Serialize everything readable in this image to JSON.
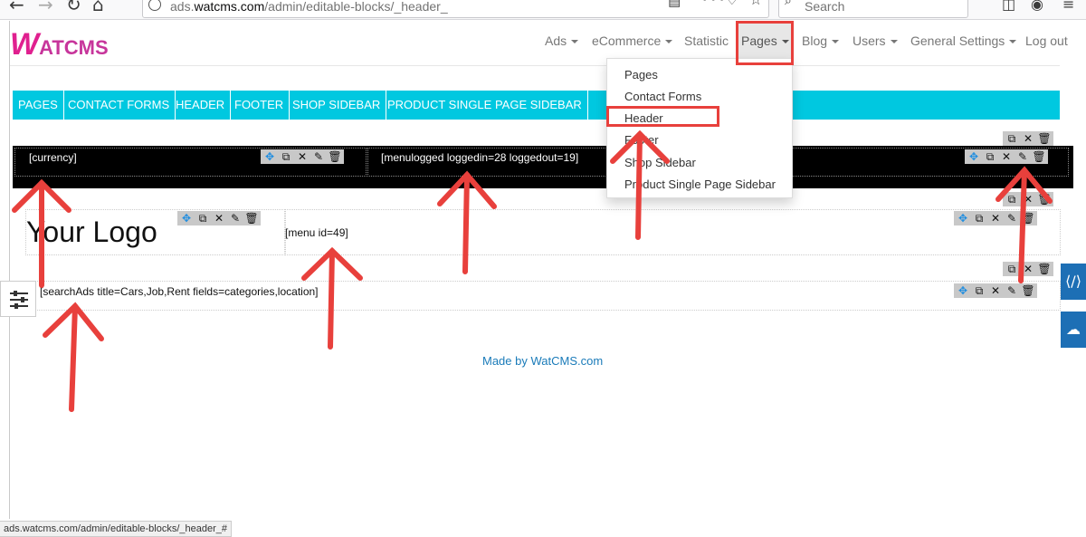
{
  "browser": {
    "url_prefix": "ads.",
    "url_domain": "watcms.com",
    "url_path": "/admin/editable-blocks/_header_",
    "search_placeholder": "Search",
    "status_url": "ads.watcms.com/admin/editable-blocks/_header_#"
  },
  "brand": {
    "logo_w": "W",
    "logo_rest": "ATCMS"
  },
  "navbar": {
    "items": [
      {
        "label": "Ads",
        "caret": true
      },
      {
        "label": "eCommerce",
        "caret": true
      },
      {
        "label": "Statistic",
        "caret": false
      },
      {
        "label": "Pages",
        "caret": true
      },
      {
        "label": "Blog",
        "caret": true
      },
      {
        "label": "Users",
        "caret": true
      },
      {
        "label": "General Settings",
        "caret": true
      },
      {
        "label": "Log out",
        "caret": false
      }
    ]
  },
  "pages_dropdown": {
    "items": [
      "Pages",
      "Contact Forms",
      "Header",
      "Footer",
      "Shop Sidebar",
      "Product Single Page Sidebar"
    ],
    "selected": "Header"
  },
  "tabs": [
    "PAGES",
    "CONTACT FORMS",
    "HEADER",
    "FOOTER",
    "SHOP SIDEBAR",
    "PRODUCT SINGLE PAGE SIDEBAR"
  ],
  "blocks": {
    "currency": "[currency]",
    "menulogged": "[menulogged loggedin=28 loggedout=19]",
    "logo": "Your Logo",
    "menu": "[menu id=49]",
    "search_ads": "[searchAds title=Cars,Job,Rent fields=categories,location]"
  },
  "footer": {
    "made_by": "Made by WatCMS.com"
  },
  "icons": {
    "move": "move-icon",
    "clone": "clone-icon",
    "settings": "tools-icon",
    "edit": "pencil-icon",
    "delete": "trash-icon"
  },
  "colors": {
    "tab_bar": "#00c8e0",
    "annotation": "#e8403c",
    "link": "#1a7bb9",
    "brand": "#e0208f"
  }
}
